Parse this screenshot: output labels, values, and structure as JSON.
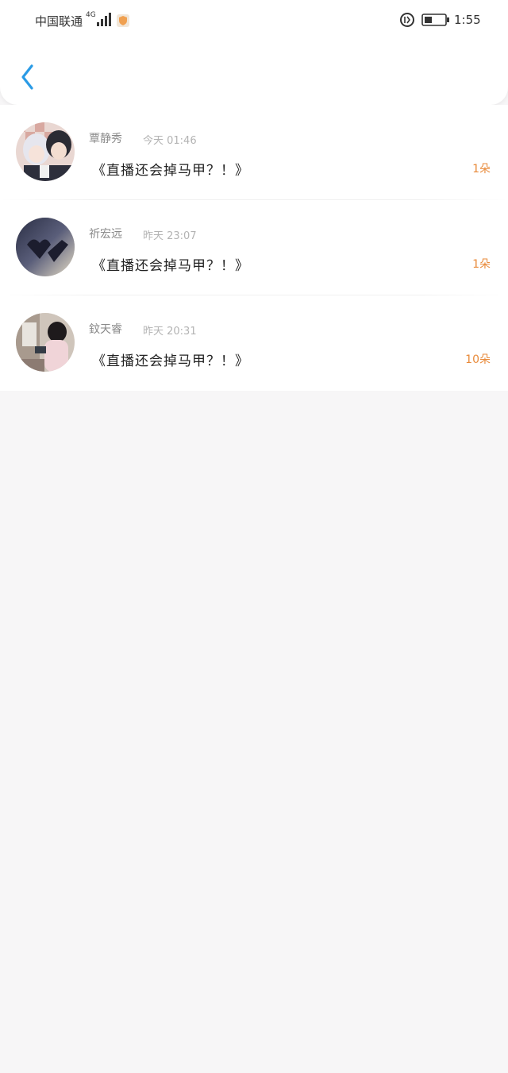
{
  "status_bar": {
    "carrier": "中国联通",
    "network": "4G",
    "time": "1:55"
  },
  "header": {
    "back_icon": "chevron-left-icon",
    "accent_color": "#2a9be6"
  },
  "gifts": [
    {
      "name": "覃静秀",
      "time": "今天 01:46",
      "title": "《直播还会掉马甲？！》",
      "count": "1朵"
    },
    {
      "name": "祈宏远",
      "time": "昨天 23:07",
      "title": "《直播还会掉马甲？！》",
      "count": "1朵"
    },
    {
      "name": "鈫天睿",
      "time": "昨天 20:31",
      "title": "《直播还会掉马甲？！》",
      "count": "10朵"
    }
  ],
  "colors": {
    "count_orange": "#e88a3a",
    "background": "#f7f6f7"
  }
}
